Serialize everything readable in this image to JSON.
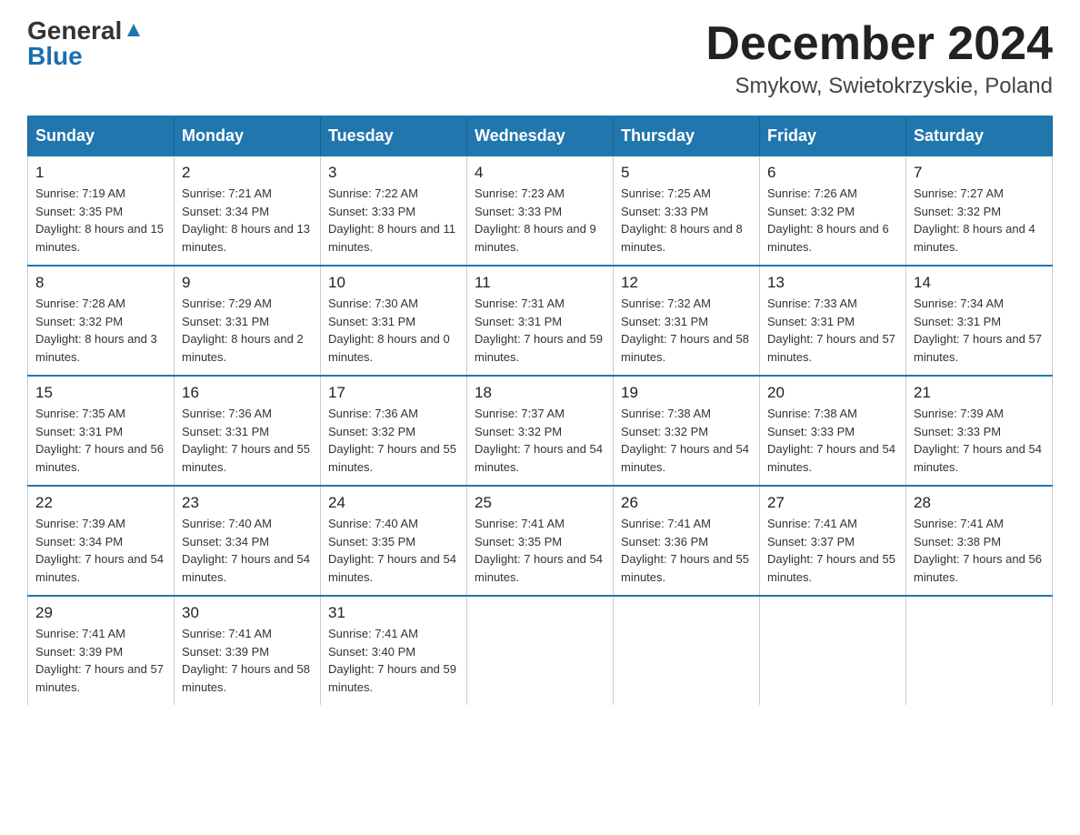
{
  "header": {
    "logo_general": "General",
    "logo_blue": "Blue",
    "title": "December 2024",
    "location": "Smykow, Swietokrzyskie, Poland"
  },
  "weekdays": [
    "Sunday",
    "Monday",
    "Tuesday",
    "Wednesday",
    "Thursday",
    "Friday",
    "Saturday"
  ],
  "weeks": [
    [
      {
        "day": "1",
        "sunrise": "7:19 AM",
        "sunset": "3:35 PM",
        "daylight": "8 hours and 15 minutes."
      },
      {
        "day": "2",
        "sunrise": "7:21 AM",
        "sunset": "3:34 PM",
        "daylight": "8 hours and 13 minutes."
      },
      {
        "day": "3",
        "sunrise": "7:22 AM",
        "sunset": "3:33 PM",
        "daylight": "8 hours and 11 minutes."
      },
      {
        "day": "4",
        "sunrise": "7:23 AM",
        "sunset": "3:33 PM",
        "daylight": "8 hours and 9 minutes."
      },
      {
        "day": "5",
        "sunrise": "7:25 AM",
        "sunset": "3:33 PM",
        "daylight": "8 hours and 8 minutes."
      },
      {
        "day": "6",
        "sunrise": "7:26 AM",
        "sunset": "3:32 PM",
        "daylight": "8 hours and 6 minutes."
      },
      {
        "day": "7",
        "sunrise": "7:27 AM",
        "sunset": "3:32 PM",
        "daylight": "8 hours and 4 minutes."
      }
    ],
    [
      {
        "day": "8",
        "sunrise": "7:28 AM",
        "sunset": "3:32 PM",
        "daylight": "8 hours and 3 minutes."
      },
      {
        "day": "9",
        "sunrise": "7:29 AM",
        "sunset": "3:31 PM",
        "daylight": "8 hours and 2 minutes."
      },
      {
        "day": "10",
        "sunrise": "7:30 AM",
        "sunset": "3:31 PM",
        "daylight": "8 hours and 0 minutes."
      },
      {
        "day": "11",
        "sunrise": "7:31 AM",
        "sunset": "3:31 PM",
        "daylight": "7 hours and 59 minutes."
      },
      {
        "day": "12",
        "sunrise": "7:32 AM",
        "sunset": "3:31 PM",
        "daylight": "7 hours and 58 minutes."
      },
      {
        "day": "13",
        "sunrise": "7:33 AM",
        "sunset": "3:31 PM",
        "daylight": "7 hours and 57 minutes."
      },
      {
        "day": "14",
        "sunrise": "7:34 AM",
        "sunset": "3:31 PM",
        "daylight": "7 hours and 57 minutes."
      }
    ],
    [
      {
        "day": "15",
        "sunrise": "7:35 AM",
        "sunset": "3:31 PM",
        "daylight": "7 hours and 56 minutes."
      },
      {
        "day": "16",
        "sunrise": "7:36 AM",
        "sunset": "3:31 PM",
        "daylight": "7 hours and 55 minutes."
      },
      {
        "day": "17",
        "sunrise": "7:36 AM",
        "sunset": "3:32 PM",
        "daylight": "7 hours and 55 minutes."
      },
      {
        "day": "18",
        "sunrise": "7:37 AM",
        "sunset": "3:32 PM",
        "daylight": "7 hours and 54 minutes."
      },
      {
        "day": "19",
        "sunrise": "7:38 AM",
        "sunset": "3:32 PM",
        "daylight": "7 hours and 54 minutes."
      },
      {
        "day": "20",
        "sunrise": "7:38 AM",
        "sunset": "3:33 PM",
        "daylight": "7 hours and 54 minutes."
      },
      {
        "day": "21",
        "sunrise": "7:39 AM",
        "sunset": "3:33 PM",
        "daylight": "7 hours and 54 minutes."
      }
    ],
    [
      {
        "day": "22",
        "sunrise": "7:39 AM",
        "sunset": "3:34 PM",
        "daylight": "7 hours and 54 minutes."
      },
      {
        "day": "23",
        "sunrise": "7:40 AM",
        "sunset": "3:34 PM",
        "daylight": "7 hours and 54 minutes."
      },
      {
        "day": "24",
        "sunrise": "7:40 AM",
        "sunset": "3:35 PM",
        "daylight": "7 hours and 54 minutes."
      },
      {
        "day": "25",
        "sunrise": "7:41 AM",
        "sunset": "3:35 PM",
        "daylight": "7 hours and 54 minutes."
      },
      {
        "day": "26",
        "sunrise": "7:41 AM",
        "sunset": "3:36 PM",
        "daylight": "7 hours and 55 minutes."
      },
      {
        "day": "27",
        "sunrise": "7:41 AM",
        "sunset": "3:37 PM",
        "daylight": "7 hours and 55 minutes."
      },
      {
        "day": "28",
        "sunrise": "7:41 AM",
        "sunset": "3:38 PM",
        "daylight": "7 hours and 56 minutes."
      }
    ],
    [
      {
        "day": "29",
        "sunrise": "7:41 AM",
        "sunset": "3:39 PM",
        "daylight": "7 hours and 57 minutes."
      },
      {
        "day": "30",
        "sunrise": "7:41 AM",
        "sunset": "3:39 PM",
        "daylight": "7 hours and 58 minutes."
      },
      {
        "day": "31",
        "sunrise": "7:41 AM",
        "sunset": "3:40 PM",
        "daylight": "7 hours and 59 minutes."
      },
      null,
      null,
      null,
      null
    ]
  ]
}
